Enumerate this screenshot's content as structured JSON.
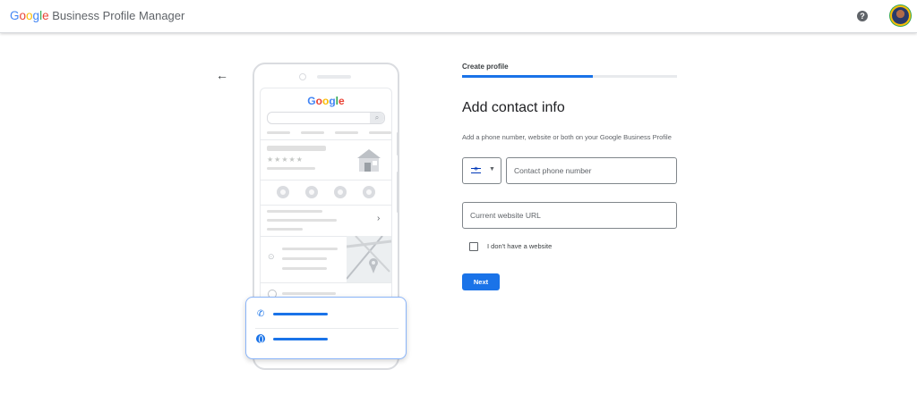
{
  "header": {
    "logo_text": "Google",
    "product_name": "Business Profile Manager",
    "help_icon": "help-circle-icon",
    "avatar": "user-avatar"
  },
  "illustration": {
    "google_text": "Google"
  },
  "form": {
    "step_label": "Create profile",
    "progress": 0.61,
    "title": "Add contact info",
    "subtitle": "Add a phone number, website or both on your Google Business Profile",
    "country_flag": "israel-flag-icon",
    "phone_placeholder": "Contact phone number",
    "website_placeholder": "Current website URL",
    "no_website_label": "I don't have a website",
    "next_label": "Next"
  },
  "colors": {
    "google_blue": "#4285F4",
    "google_red": "#EA4335",
    "google_yellow": "#FBBC05",
    "google_green": "#34A853",
    "primary_button": "#1A73E8"
  }
}
